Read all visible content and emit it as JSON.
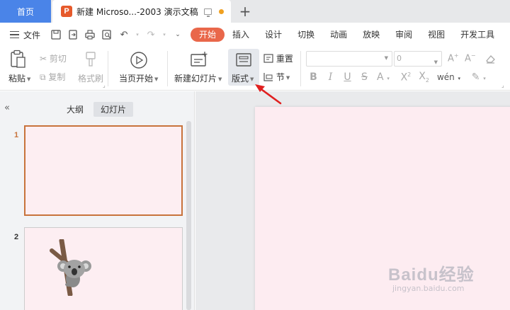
{
  "titlebar": {
    "home_tab": "首页",
    "doc_tab": {
      "logo": "P",
      "title": "新建 Microso...-2003 演示文稿"
    },
    "new_tab": "+"
  },
  "menubar": {
    "file": "文件",
    "tabs": [
      "开始",
      "插入",
      "设计",
      "切换",
      "动画",
      "放映",
      "审阅",
      "视图",
      "开发工具"
    ],
    "active_tab": "开始"
  },
  "ribbon": {
    "paste": "粘贴",
    "cut": "剪切",
    "copy": "复制",
    "format_painter": "格式刷",
    "play_from_current": "当页开始",
    "new_slide": "新建幻灯片",
    "layout": "版式",
    "reset": "重置",
    "section": "节",
    "font_size": "0"
  },
  "panel": {
    "outline_tab": "大纲",
    "slides_tab": "幻灯片",
    "slide_numbers": [
      "1",
      "2"
    ]
  },
  "watermark": {
    "main": "Baidu经验",
    "sub": "jingyan.baidu.com"
  },
  "colors": {
    "accent": "#e9674a",
    "home_tab": "#4a84e8",
    "selected_border": "#c8733c",
    "slide_bg": "#fdecf1"
  }
}
